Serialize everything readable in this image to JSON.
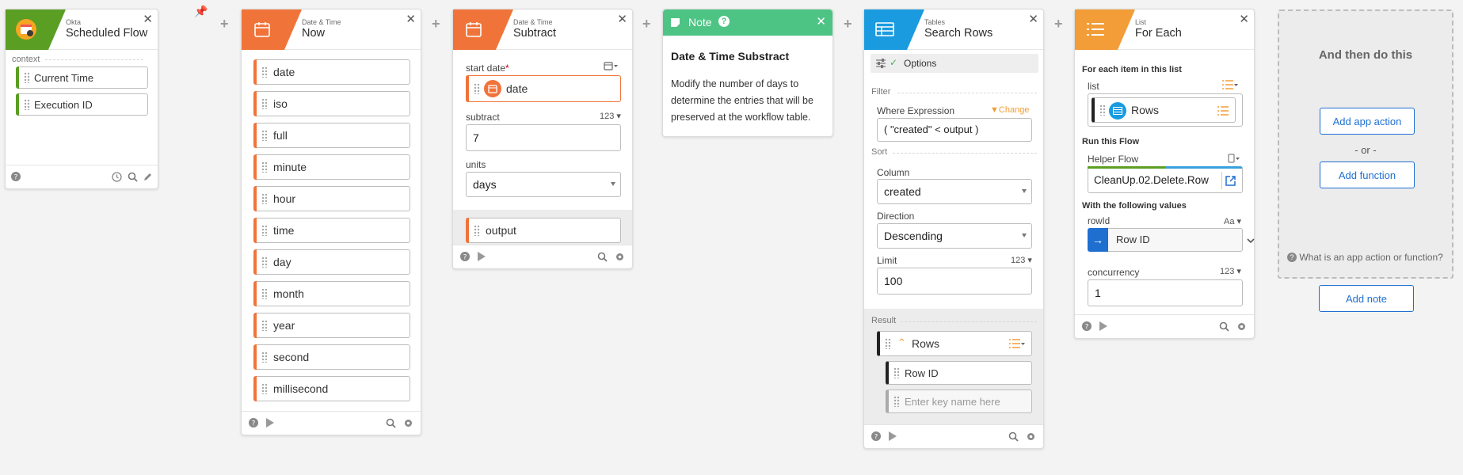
{
  "cards": {
    "okta": {
      "sub": "Okta",
      "title": "Scheduled Flow",
      "section": "context",
      "fields": [
        "Current Time",
        "Execution ID"
      ]
    },
    "now": {
      "sub": "Date & Time",
      "title": "Now",
      "fields": [
        "date",
        "iso",
        "full",
        "minute",
        "hour",
        "time",
        "day",
        "month",
        "year",
        "second",
        "millisecond"
      ]
    },
    "subtract": {
      "sub": "Date & Time",
      "title": "Subtract",
      "start_label": "start date",
      "required": "*",
      "start_value": "date",
      "subtract_label": "subtract",
      "subtract_type": "123",
      "subtract_value": "7",
      "units_label": "units",
      "units_value": "days",
      "output": "output"
    },
    "note": {
      "header": "Note",
      "help": "?",
      "title": "Date & Time Substract",
      "body": "Modify the number of days to determine the entries that will be preserved at the workflow table."
    },
    "search": {
      "sub": "Tables",
      "title": "Search Rows",
      "options": "Options",
      "filter_label": "Filter",
      "where_label": "Where Expression",
      "change": "Change",
      "where_value": "( \"created\" < output )",
      "sort_label": "Sort",
      "column_label": "Column",
      "column_value": "created",
      "direction_label": "Direction",
      "direction_value": "Descending",
      "limit_label": "Limit",
      "limit_type": "123",
      "limit_value": "100",
      "result_label": "Result",
      "rows": "Rows",
      "row_id": "Row ID",
      "placeholder": "Enter key name here"
    },
    "foreach": {
      "sub": "List",
      "title": "For Each",
      "each_label": "For each item in this list",
      "list_label": "list",
      "list_value": "Rows",
      "run_label": "Run this Flow",
      "helper_label": "Helper Flow",
      "helper_value": "CleanUp.02.Delete.Row",
      "values_label": "With the following values",
      "rowid_label": "rowId",
      "rowid_type": "Aa",
      "rowid_value": "Row ID",
      "concurrency_label": "concurrency",
      "concurrency_type": "123",
      "concurrency_value": "1"
    }
  },
  "then": {
    "title": "And then do this",
    "add_app_action": "Add app action",
    "or": "- or -",
    "add_function": "Add function",
    "help": "What is an app action or function?",
    "add_note": "Add note"
  },
  "colors": {
    "okta_green": "#5a9e23",
    "datetime_orange": "#f0743a",
    "tables_blue": "#1a9be0",
    "list_orange": "#f29d38",
    "note_green": "#4dc484",
    "link_blue": "#1f6fd1"
  },
  "icons": {
    "okta": "calendar-clock-icon",
    "datetime": "calendar-icon",
    "tables": "table-icon",
    "list": "list-icon"
  }
}
